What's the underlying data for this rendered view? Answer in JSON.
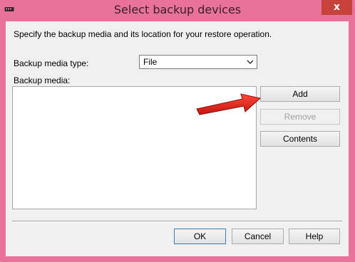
{
  "window": {
    "title": "Select backup devices",
    "close_glyph": "x",
    "app_icon": "sql-device-icon"
  },
  "dialog": {
    "instruction": "Specify the backup media and its location for your restore operation.",
    "media_type_label": "Backup media type:",
    "media_type_value": "File",
    "media_label": "Backup media:",
    "media_items": []
  },
  "buttons": {
    "add": "Add",
    "remove": "Remove",
    "contents": "Contents",
    "ok": "OK",
    "cancel": "Cancel",
    "help": "Help"
  },
  "annotation": {
    "arrow_color": "#e0261b",
    "points_to": "add-button"
  },
  "colors": {
    "window_frame": "#e8729a",
    "close_button": "#c7423b",
    "dialog_bg": "#f0f0f0"
  }
}
